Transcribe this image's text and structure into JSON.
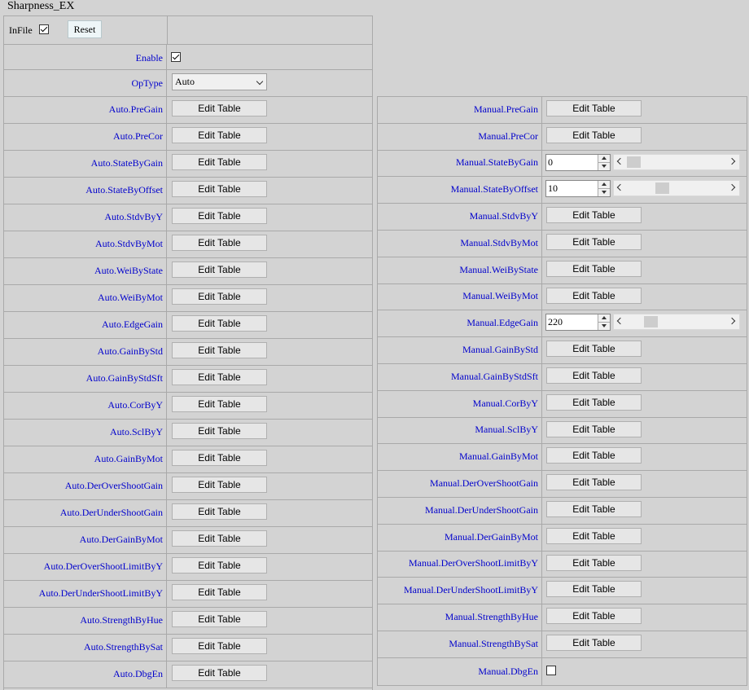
{
  "page_title": "Sharpness_EX",
  "header": {
    "infile_label": "InFile",
    "infile_checked": true,
    "reset_label": "Reset"
  },
  "enable": {
    "label": "Enable",
    "checked": true
  },
  "optype": {
    "label": "OpType",
    "value": "Auto"
  },
  "edit_label": "Edit Table",
  "auto_params": [
    "Auto.PreGain",
    "Auto.PreCor",
    "Auto.StateByGain",
    "Auto.StateByOffset",
    "Auto.StdvByY",
    "Auto.StdvByMot",
    "Auto.WeiByState",
    "Auto.WeiByMot",
    "Auto.EdgeGain",
    "Auto.GainByStd",
    "Auto.GainByStdSft",
    "Auto.CorByY",
    "Auto.SclByY",
    "Auto.GainByMot",
    "Auto.DerOverShootGain",
    "Auto.DerUnderShootGain",
    "Auto.DerGainByMot",
    "Auto.DerOverShootLimitByY",
    "Auto.DerUnderShootLimitByY",
    "Auto.StrengthByHue",
    "Auto.StrengthBySat",
    "Auto.DbgEn"
  ],
  "manual_params": [
    {
      "label": "Manual.PreGain",
      "type": "edit"
    },
    {
      "label": "Manual.PreCor",
      "type": "edit"
    },
    {
      "label": "Manual.StateByGain",
      "type": "slider",
      "value": "0",
      "fraction": 0.0
    },
    {
      "label": "Manual.StateByOffset",
      "type": "slider",
      "value": "10",
      "fraction": 0.33
    },
    {
      "label": "Manual.StdvByY",
      "type": "edit"
    },
    {
      "label": "Manual.StdvByMot",
      "type": "edit"
    },
    {
      "label": "Manual.WeiByState",
      "type": "edit"
    },
    {
      "label": "Manual.WeiByMot",
      "type": "edit"
    },
    {
      "label": "Manual.EdgeGain",
      "type": "slider",
      "value": "220",
      "fraction": 0.2
    },
    {
      "label": "Manual.GainByStd",
      "type": "edit"
    },
    {
      "label": "Manual.GainByStdSft",
      "type": "edit"
    },
    {
      "label": "Manual.CorByY",
      "type": "edit"
    },
    {
      "label": "Manual.SclByY",
      "type": "edit"
    },
    {
      "label": "Manual.GainByMot",
      "type": "edit"
    },
    {
      "label": "Manual.DerOverShootGain",
      "type": "edit"
    },
    {
      "label": "Manual.DerUnderShootGain",
      "type": "edit"
    },
    {
      "label": "Manual.DerGainByMot",
      "type": "edit"
    },
    {
      "label": "Manual.DerOverShootLimitByY",
      "type": "edit"
    },
    {
      "label": "Manual.DerUnderShootLimitByY",
      "type": "edit"
    },
    {
      "label": "Manual.StrengthByHue",
      "type": "edit"
    },
    {
      "label": "Manual.StrengthBySat",
      "type": "edit"
    },
    {
      "label": "Manual.DbgEn",
      "type": "checkbox",
      "checked": false
    }
  ],
  "colors": {
    "label_text": "#0000cc",
    "background": "#d3d3d3",
    "border": "#a9a9a9"
  }
}
